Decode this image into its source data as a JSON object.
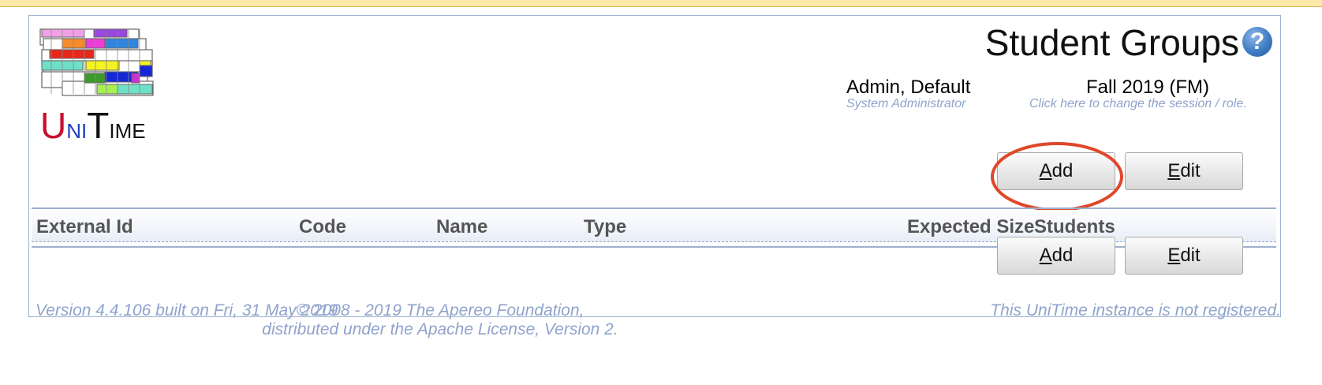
{
  "page": {
    "title": "Student Groups"
  },
  "header": {
    "help_icon": "help-icon",
    "user": {
      "name": "Admin, Default",
      "role": "System Administrator"
    },
    "session": {
      "name": "Fall 2019 (FM)",
      "hint": "Click here to change the session / role."
    }
  },
  "logo": {
    "text": "UniTime",
    "letters": [
      "U",
      "NI",
      "T",
      "IME"
    ],
    "colors": {
      "U": "#c8102e",
      "N": "#1e3fbf",
      "I": "#0a8f2f",
      "T": "#111111",
      "IME": "#111111"
    }
  },
  "buttons": {
    "add": {
      "underlined": "A",
      "rest": "dd"
    },
    "edit": {
      "underlined": "E",
      "rest": "dit"
    }
  },
  "table": {
    "columns": [
      "External Id",
      "Code",
      "Name",
      "Type",
      "Expected Size",
      "Students"
    ],
    "rows": []
  },
  "annotation": {
    "highlight_color": "#e0472a",
    "target": "Add"
  },
  "footer": {
    "version": "Version 4.4.106 built on Fri, 31 May 2019",
    "copyright_line1": "© 2008 - 2019 The Apereo Foundation,",
    "copyright_line2": "distributed under the Apache License, Version 2.",
    "registration": "This UniTime instance is not registered."
  }
}
